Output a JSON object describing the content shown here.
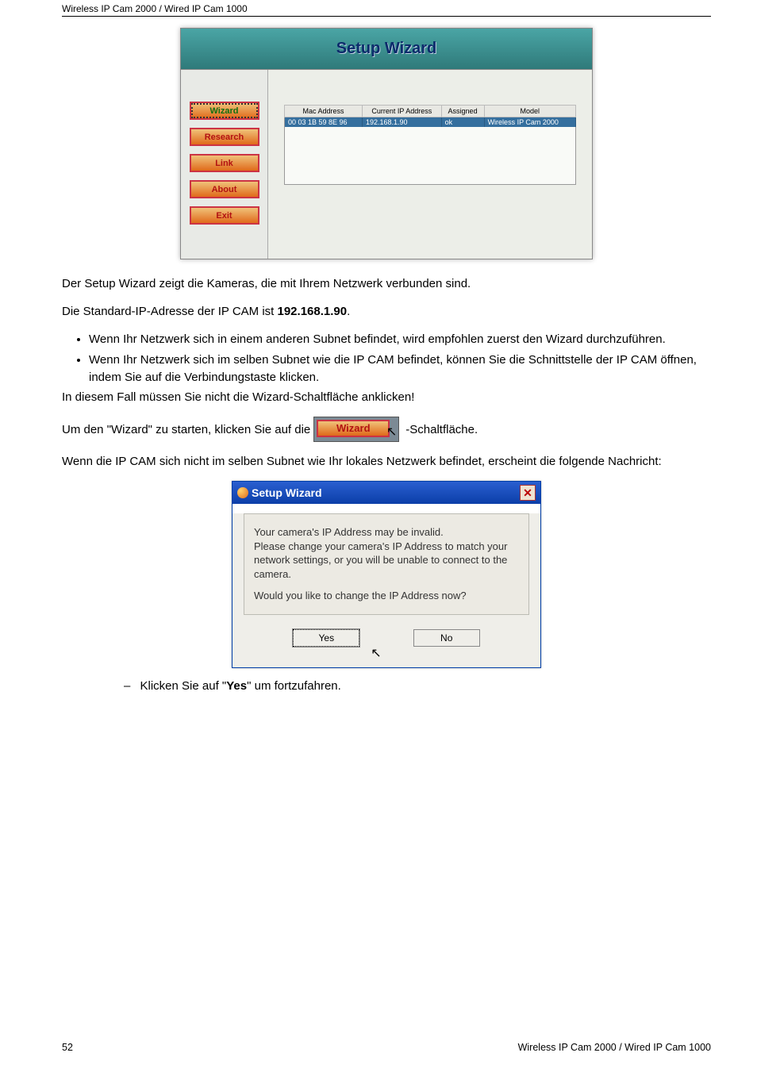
{
  "header": {
    "title": "Wireless IP Cam 2000 / Wired IP Cam 1000"
  },
  "wizard": {
    "banner": "Setup Wizard",
    "side": {
      "wizard": "Wizard",
      "research": "Research",
      "link": "Link",
      "about": "About",
      "exit": "Exit"
    },
    "table": {
      "headers": {
        "mac": "Mac Address",
        "ip": "Current IP Address",
        "assigned": "Assigned",
        "model": "Model"
      },
      "row": {
        "mac": "00 03 1B 59 8E 96",
        "ip": "192.168.1.90",
        "assigned": "ok",
        "model": "Wireless IP Cam 2000"
      }
    }
  },
  "para1": "Der Setup Wizard zeigt die Kameras, die mit Ihrem Netzwerk verbunden sind.",
  "para2_pre": "Die Standard-IP-Adresse der IP CAM ist ",
  "para2_bold": "192.168.1.90",
  "para2_post": ".",
  "bullet1": "Wenn Ihr Netzwerk sich in einem anderen Subnet befindet, wird empfohlen zuerst den Wizard durchzuführen.",
  "bullet2": "Wenn Ihr Netzwerk sich im selben Subnet wie die IP CAM befindet, können Sie die Schnittstelle der IP CAM öffnen, indem Sie auf die Verbindungstaste klicken.",
  "after_bullets": "In diesem Fall müssen Sie nicht die Wizard-Schaltfläche anklicken!",
  "wizard_line_pre": "Um den \"Wizard\" zu starten, klicken Sie auf die ",
  "wizard_btn_label": "Wizard",
  "wizard_line_post": "-Schaltfläche.",
  "para3": "Wenn die IP CAM sich nicht im selben Subnet wie Ihr lokales Netzwerk befindet, erscheint die folgende Nachricht:",
  "dialog": {
    "title": "Setup Wizard",
    "line1": "Your camera's IP Address may be invalid.",
    "line2": "Please change your camera's IP Address to match your network settings, or you will be unable to connect to the camera.",
    "line3": "Would you like to change the IP Address now?",
    "yes": "Yes",
    "no": "No"
  },
  "dash": {
    "pre": "Klicken Sie auf \"",
    "bold": "Yes",
    "post": "\" um fortzufahren."
  },
  "footer": {
    "page": "52",
    "right": "Wireless IP Cam 2000 / Wired IP Cam 1000"
  }
}
